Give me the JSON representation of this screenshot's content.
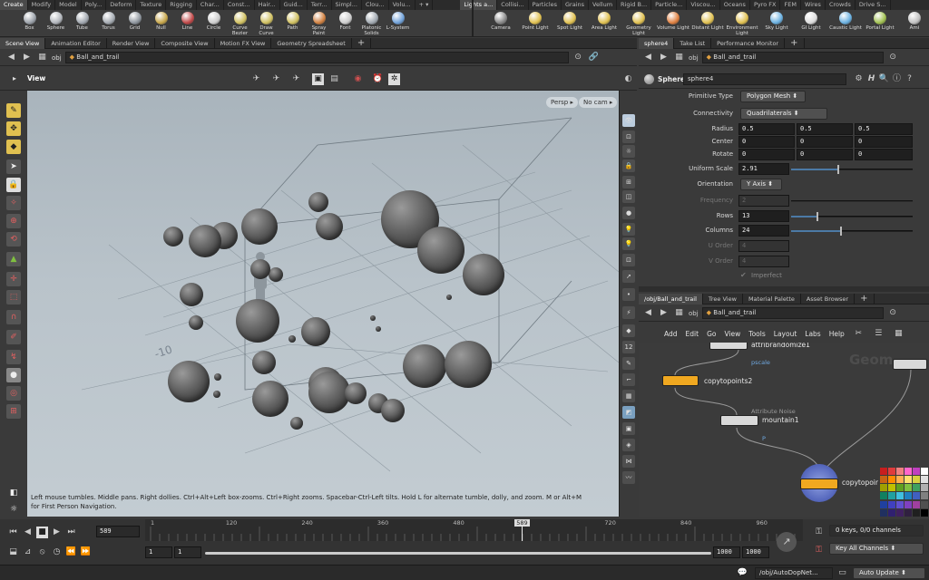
{
  "shelf_tabs_left": [
    "Create",
    "Modify",
    "Model",
    "Poly...",
    "Deform",
    "Texture",
    "Rigging",
    "Char...",
    "Const...",
    "Hair...",
    "Guid...",
    "Terr...",
    "Simpl...",
    "Clou...",
    "Volu..."
  ],
  "shelf_tabs_right": [
    "Lights a...",
    "Collisi...",
    "Particles",
    "Grains",
    "Vellum",
    "Rigid B...",
    "Particle...",
    "Viscou...",
    "Oceans",
    "Pyro FX",
    "FEM",
    "Wires",
    "Crowds",
    "Drive S..."
  ],
  "tools_left": [
    {
      "label": "Box",
      "color": "#9aa0a8"
    },
    {
      "label": "Sphere",
      "color": "#b0b4ba"
    },
    {
      "label": "Tube",
      "color": "#a0a6ae"
    },
    {
      "label": "Torus",
      "color": "#a3a9b0"
    },
    {
      "label": "Grid",
      "color": "#8e959d"
    },
    {
      "label": "Null",
      "color": "#c7a64a"
    },
    {
      "label": "Line",
      "color": "#c04848"
    },
    {
      "label": "Circle",
      "color": "#cccccc"
    },
    {
      "label": "Curve Bezier",
      "color": "#d0c060"
    },
    {
      "label": "Draw Curve",
      "color": "#d0c060"
    },
    {
      "label": "Path",
      "color": "#d0c060"
    },
    {
      "label": "Spray Paint",
      "color": "#d08040"
    },
    {
      "label": "Font",
      "color": "#cccccc"
    },
    {
      "label": "Platonic Solids",
      "color": "#a0a8b0"
    },
    {
      "label": "L-System",
      "color": "#6fa0d8"
    }
  ],
  "tools_right": [
    {
      "label": "Camera",
      "color": "#888888"
    },
    {
      "label": "Point Light",
      "color": "#e0c050"
    },
    {
      "label": "Spot Light",
      "color": "#e0c050"
    },
    {
      "label": "Area Light",
      "color": "#e0c050"
    },
    {
      "label": "Geometry Light",
      "color": "#e0c050"
    },
    {
      "label": "Volume Light",
      "color": "#e08040"
    },
    {
      "label": "Distant Light",
      "color": "#e0c050"
    },
    {
      "label": "Environment Light",
      "color": "#e0c050"
    },
    {
      "label": "Sky Light",
      "color": "#6ab0e0"
    },
    {
      "label": "GI Light",
      "color": "#dddddd"
    },
    {
      "label": "Caustic Light",
      "color": "#6ab0e0"
    },
    {
      "label": "Portal Light",
      "color": "#a0c050"
    },
    {
      "label": "Ami",
      "color": "#c0c0c0"
    }
  ],
  "left_pane": {
    "tabs": [
      "Scene View",
      "Animation Editor",
      "Render View",
      "Composite View",
      "Motion FX View",
      "Geometry Spreadsheet"
    ],
    "path_root": "obj",
    "path_node": "Ball_and_trail",
    "view_label": "View",
    "persp": "Persp",
    "cam": "No cam",
    "grid_label": "-10",
    "status": "Left mouse tumbles. Middle pans. Right dollies. Ctrl+Alt+Left box-zooms. Ctrl+Right zooms. Spacebar-Ctrl-Left tilts. Hold L for alternate tumble, dolly, and zoom.     M or Alt+M for First Person Navigation."
  },
  "params": {
    "tabs": [
      "sphere4",
      "Take List",
      "Performance Monitor"
    ],
    "path_root": "obj",
    "path_node": "Ball_and_trail",
    "node_type": "Sphere",
    "node_name": "sphere4",
    "primitive_type_label": "Primitive Type",
    "primitive_type": "Polygon Mesh",
    "connectivity_label": "Connectivity",
    "connectivity": "Quadrilaterals",
    "radius_label": "Radius",
    "radius": [
      "0.5",
      "0.5",
      "0.5"
    ],
    "center_label": "Center",
    "center": [
      "0",
      "0",
      "0"
    ],
    "rotate_label": "Rotate",
    "rotate": [
      "0",
      "0",
      "0"
    ],
    "uniform_scale_label": "Uniform Scale",
    "uniform_scale": "2.91",
    "uniform_scale_fill": 0.38,
    "orientation_label": "Orientation",
    "orientation": "Y Axis",
    "frequency_label": "Frequency",
    "frequency": "2",
    "rows_label": "Rows",
    "rows": "13",
    "rows_fill": 0.21,
    "columns_label": "Columns",
    "columns": "24",
    "columns_fill": 0.4,
    "uorder_label": "U Order",
    "uorder": "4",
    "vorder_label": "V Order",
    "vorder": "4",
    "imperfect_label": "Imperfect"
  },
  "network": {
    "tabs": [
      "/obj/Ball_and_trail",
      "Tree View",
      "Material Palette",
      "Asset Browser"
    ],
    "path_root": "obj",
    "path_node": "Ball_and_trail",
    "menu": [
      "Add",
      "Edit",
      "Go",
      "View",
      "Tools",
      "Layout",
      "Labs",
      "Help"
    ],
    "watermark": "Geom",
    "nodes": {
      "n1": {
        "name": "attribrandomize1",
        "sub": "pscale"
      },
      "n2": {
        "name": "copytopoints2"
      },
      "n3": {
        "type": "Attribute Noise",
        "name": "mountain1",
        "sub": "P"
      },
      "n4": {
        "name": "copytopoir"
      }
    },
    "palette": [
      "#c81e1e",
      "#e03c3c",
      "#f08080",
      "#ff66cc",
      "#c040c0",
      "#ffffff",
      "#c86414",
      "#ff8c00",
      "#ffb050",
      "#ffe070",
      "#d8d040",
      "#e0e0e0",
      "#a0a000",
      "#c0c000",
      "#60a020",
      "#80c040",
      "#40a060",
      "#b0b0b0",
      "#108060",
      "#20a0a0",
      "#40c0e0",
      "#2080c0",
      "#4060c0",
      "#808080",
      "#2040a0",
      "#4040c0",
      "#6050d0",
      "#8040c0",
      "#a040a0",
      "#505050",
      "#203060",
      "#302070",
      "#402060",
      "#302040",
      "#202020",
      "#000000"
    ]
  },
  "timeline": {
    "ticks": [
      "1",
      "120",
      "240",
      "360",
      "480",
      "589",
      "720",
      "840",
      "960"
    ],
    "current_frame": "589",
    "current_fraction": 0.588,
    "range_start": "1",
    "range_start2": "1",
    "range_end": "1000",
    "range_end2": "1000",
    "keys_info": "0 keys, 0/0 channels",
    "key_channels": "Key All Channels",
    "path": "/obj/AutoDopNet...",
    "update_mode": "Auto Update"
  }
}
